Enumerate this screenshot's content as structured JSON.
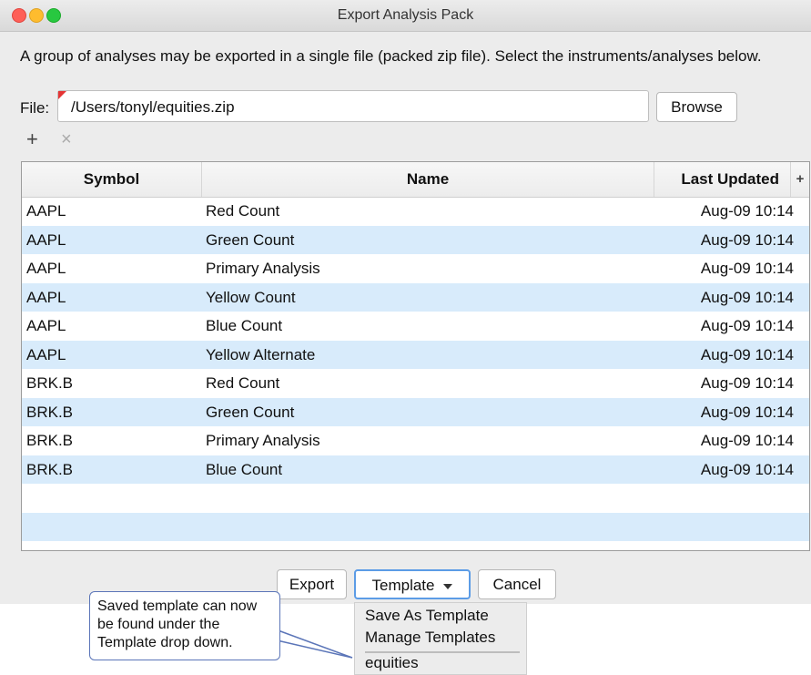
{
  "window": {
    "title": "Export Analysis Pack"
  },
  "description": "A group of analyses may be exported in a single file (packed zip file). Select the instruments/analyses below.",
  "file": {
    "label": "File:",
    "value": "/Users/tonyl/equities.zip",
    "browse_label": "Browse"
  },
  "toolbar": {
    "add_icon": "plus-icon",
    "remove_icon": "close-icon",
    "add_glyph": "+",
    "remove_glyph": "×"
  },
  "table": {
    "columns": [
      "Symbol",
      "Name",
      "Last Updated"
    ],
    "add_column_glyph": "+",
    "rows": [
      {
        "symbol": "AAPL",
        "name": "Red Count",
        "updated": "Aug-09 10:14"
      },
      {
        "symbol": "AAPL",
        "name": "Green Count",
        "updated": "Aug-09 10:14"
      },
      {
        "symbol": "AAPL",
        "name": "Primary Analysis",
        "updated": "Aug-09 10:14"
      },
      {
        "symbol": "AAPL",
        "name": "Yellow Count",
        "updated": "Aug-09 10:14"
      },
      {
        "symbol": "AAPL",
        "name": "Blue Count",
        "updated": "Aug-09 10:14"
      },
      {
        "symbol": "AAPL",
        "name": "Yellow Alternate",
        "updated": "Aug-09 10:14"
      },
      {
        "symbol": "BRK.B",
        "name": "Red Count",
        "updated": "Aug-09 10:14"
      },
      {
        "symbol": "BRK.B",
        "name": "Green Count",
        "updated": "Aug-09 10:14"
      },
      {
        "symbol": "BRK.B",
        "name": "Primary Analysis",
        "updated": "Aug-09 10:14"
      },
      {
        "symbol": "BRK.B",
        "name": "Blue Count",
        "updated": "Aug-09 10:14"
      }
    ]
  },
  "buttons": {
    "export": "Export",
    "template": "Template",
    "cancel": "Cancel"
  },
  "template_menu": {
    "items": [
      "Save As Template",
      "Manage Templates",
      "equities"
    ]
  },
  "callout": {
    "text": "Saved template can now be found under the Template drop down."
  },
  "colors": {
    "row_alt": "#d8ebfb",
    "focus_ring": "#5c9ce6",
    "callout_border": "#5b75b8",
    "traffic_close": "#fe5f57",
    "traffic_min": "#febc2e",
    "traffic_max": "#28c840"
  }
}
